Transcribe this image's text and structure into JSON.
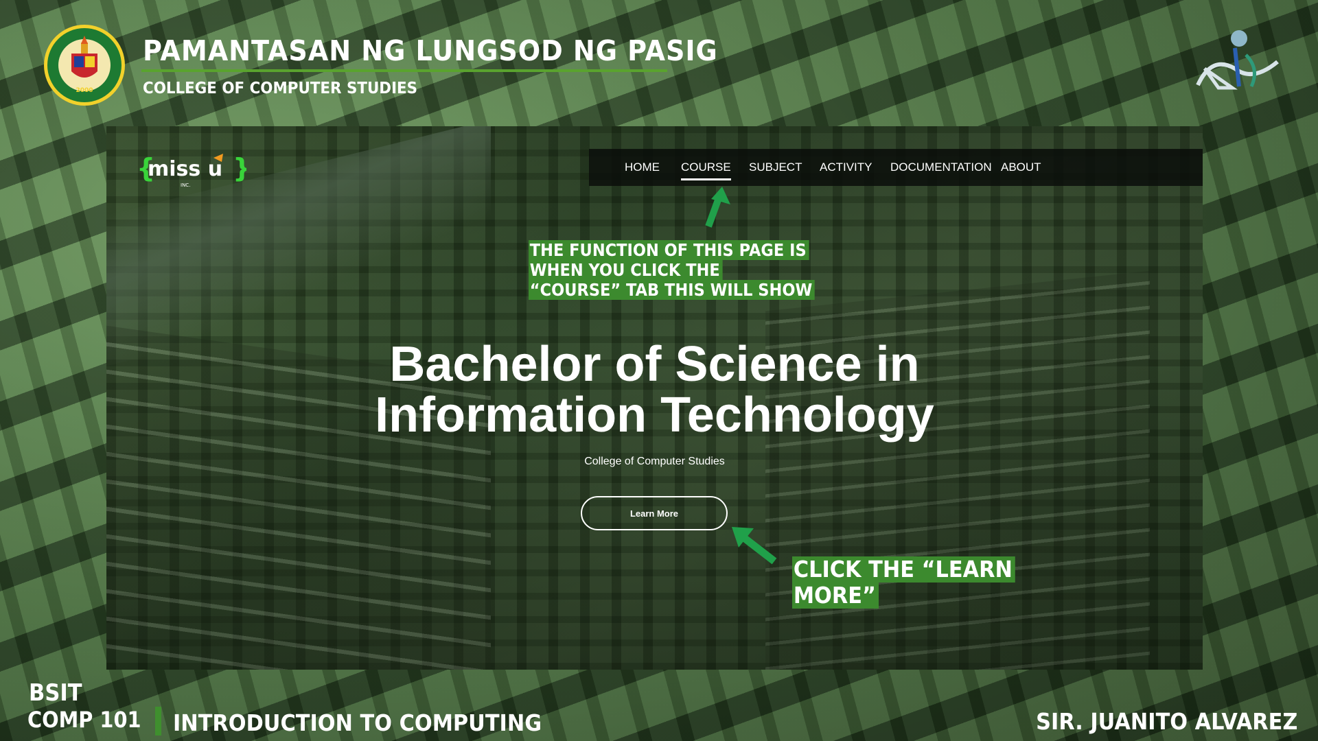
{
  "header": {
    "university": "PAMANTASAN NG LUNGSOD NG PASIG",
    "college": "COLLEGE OF COMPUTER STUDIES",
    "seal_text_top": "PAMANTASAN NG LUNGSOD NG PASIG",
    "seal_year": "2000"
  },
  "screenshot": {
    "site_logo": "{miss u}",
    "site_logo_sub": "INC.",
    "nav": {
      "items": [
        "HOME",
        "COURSE",
        "SUBJECT",
        "ACTIVITY",
        "DOCUMENTATION",
        "ABOUT"
      ],
      "active": "COURSE"
    },
    "hero": {
      "title_line1": "Bachelor of Science in",
      "title_line2": "Information Technology",
      "subtitle": "College of Computer Studies",
      "button": "Learn More"
    }
  },
  "callouts": {
    "course_note": [
      "THE FUNCTION OF THIS PAGE IS",
      "WHEN YOU CLICK THE",
      "“COURSE” TAB THIS WILL SHOW"
    ],
    "learn_more_note": [
      "CLICK THE “LEARN",
      "MORE”"
    ]
  },
  "footer": {
    "program": "BSIT",
    "course_code": "COMP 101",
    "course_name": "INTRODUCTION TO COMPUTING",
    "instructor": "SIR. JUANITO ALVAREZ"
  },
  "colors": {
    "accent_green": "#3c8a2e",
    "nav_bg": "#0a0e0a",
    "text": "#ffffff"
  }
}
